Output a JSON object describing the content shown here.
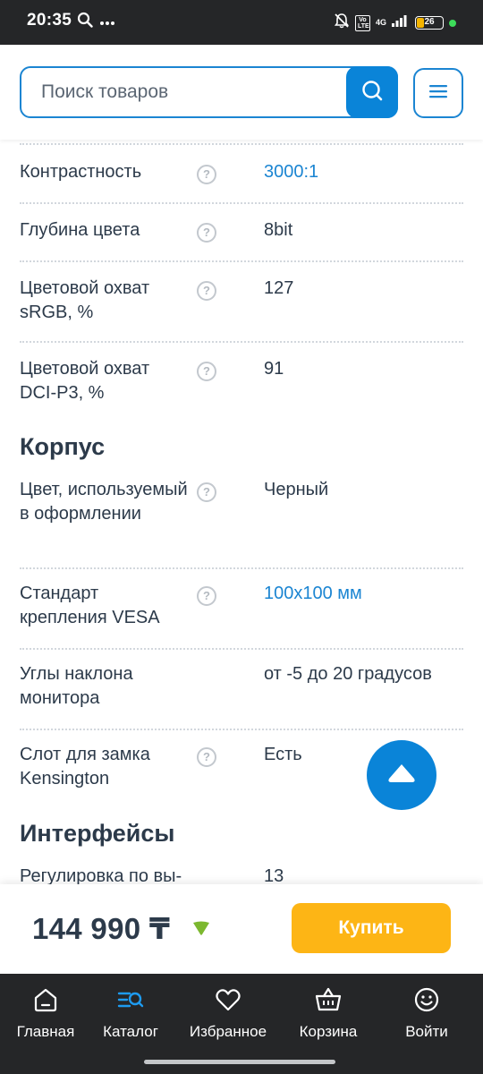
{
  "status_bar": {
    "time": "20:35",
    "battery": "26",
    "network": "4G",
    "volte": "Vo LTE"
  },
  "search": {
    "placeholder": "Поиск товаров"
  },
  "specs_top": [
    {
      "label": "Контрастность",
      "value": "3000:1",
      "link": true
    },
    {
      "label": "Глубина цвета",
      "value": "8bit",
      "link": false
    },
    {
      "label": "Цветовой охват sRGB, %",
      "value": "127",
      "link": false
    },
    {
      "label": "Цветовой охват DCI-P3, %",
      "value": "91",
      "link": false
    }
  ],
  "section_body": "Корпус",
  "specs_body": [
    {
      "label": "Цвет, используемый в оформлении",
      "value": "Черный",
      "link": false
    },
    {
      "label": "Стандарт крепления VESA",
      "value": "100x100 мм",
      "link": true
    },
    {
      "label": "Углы наклона монитора",
      "value": "от -5 до 20 градусов",
      "link": false
    },
    {
      "label": "Слот для замка Kensington",
      "value": "Есть",
      "link": false
    }
  ],
  "section_interfaces": "Интерфейсы",
  "specs_interfaces": [
    {
      "label": "Регулировка по вы-",
      "value": "13",
      "link": false
    }
  ],
  "help_icon_text": "?",
  "purchase": {
    "price": "144 990 ₸",
    "buy_label": "Купить"
  },
  "nav": [
    {
      "label": "Главная",
      "icon": "home-icon"
    },
    {
      "label": "Каталог",
      "icon": "catalog-icon"
    },
    {
      "label": "Избранное",
      "icon": "heart-icon"
    },
    {
      "label": "Корзина",
      "icon": "basket-icon"
    },
    {
      "label": "Войти",
      "icon": "smile-icon"
    }
  ],
  "colors": {
    "accent": "#0a84d8",
    "link": "#1b85d2",
    "buy": "#fdb515",
    "nav_active": "#1e9bf0",
    "badge_green": "#7cb82f"
  }
}
